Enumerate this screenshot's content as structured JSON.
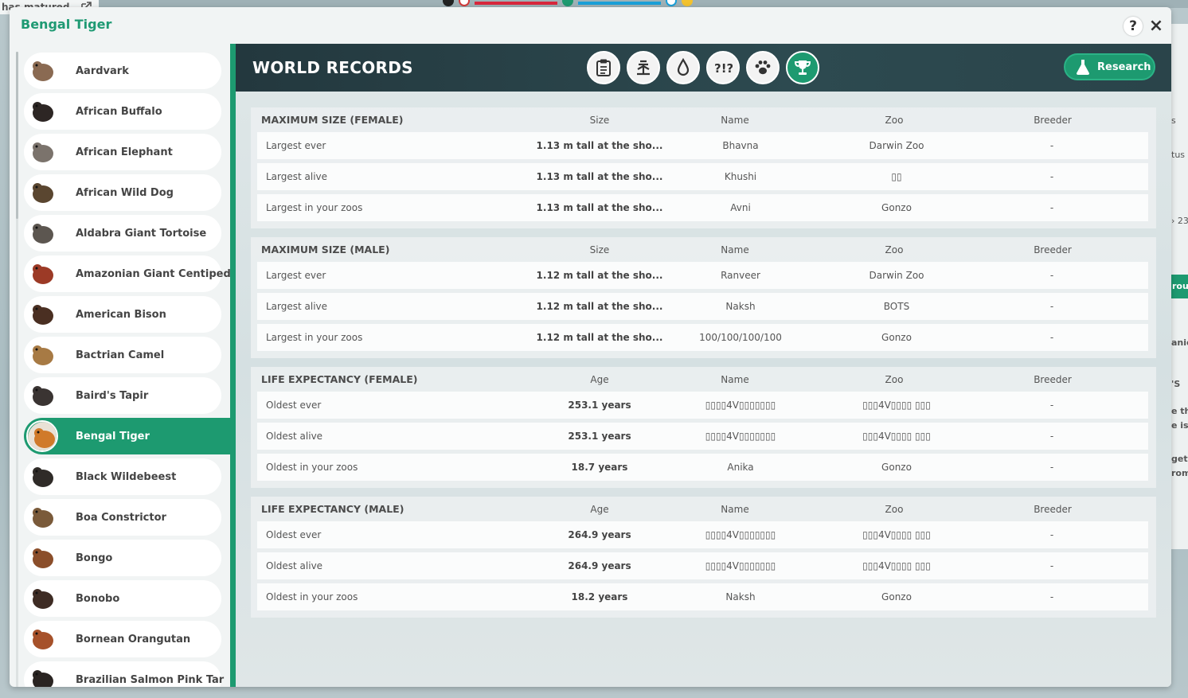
{
  "background": {
    "notice": "has matured",
    "right_fragments": [
      "s",
      "tus",
      "› 23",
      "rou",
      "anic",
      "'S",
      "e the",
      "e is.",
      "get a",
      "rom"
    ]
  },
  "window": {
    "title": "Bengal Tiger",
    "help_label": "?",
    "close_label": "×"
  },
  "sidebar": {
    "items": [
      {
        "label": "Aardvark",
        "color": "#8a6a52",
        "active": false
      },
      {
        "label": "African Buffalo",
        "color": "#2d2624",
        "active": false
      },
      {
        "label": "African Elephant",
        "color": "#7b736c",
        "active": false
      },
      {
        "label": "African Wild Dog",
        "color": "#5a4630",
        "active": false
      },
      {
        "label": "Aldabra Giant Tortoise",
        "color": "#5c5650",
        "active": false
      },
      {
        "label": "Amazonian Giant Centipede",
        "color": "#9c3a26",
        "active": false
      },
      {
        "label": "American Bison",
        "color": "#4a2f22",
        "active": false
      },
      {
        "label": "Bactrian Camel",
        "color": "#a77a44",
        "active": false
      },
      {
        "label": "Baird's Tapir",
        "color": "#3a3432",
        "active": false
      },
      {
        "label": "Bengal Tiger",
        "color": "#d07a2a",
        "active": true
      },
      {
        "label": "Black Wildebeest",
        "color": "#2f2b28",
        "active": false
      },
      {
        "label": "Boa Constrictor",
        "color": "#7a5a3a",
        "active": false
      },
      {
        "label": "Bongo",
        "color": "#8b4e2a",
        "active": false
      },
      {
        "label": "Bonobo",
        "color": "#3e2c24",
        "active": false
      },
      {
        "label": "Bornean Orangutan",
        "color": "#a6512a",
        "active": false
      },
      {
        "label": "Brazilian Salmon Pink Tar",
        "color": "#2a2422",
        "active": false
      }
    ]
  },
  "header": {
    "title": "WORLD RECORDS",
    "research_label": "Research",
    "tabs": [
      {
        "icon": "clipboard-icon"
      },
      {
        "icon": "habitat-icon"
      },
      {
        "icon": "water-drop-icon"
      },
      {
        "icon": "behaviour-icon"
      },
      {
        "icon": "paw-icon"
      },
      {
        "icon": "trophy-icon"
      }
    ]
  },
  "records": {
    "sections": [
      {
        "title": "MAXIMUM SIZE (FEMALE)",
        "columns": [
          "Size",
          "Name",
          "Zoo",
          "Breeder"
        ],
        "rows": [
          {
            "label": "Largest ever",
            "value": "1.13 m tall at the sho...",
            "name": "Bhavna",
            "zoo": "Darwin Zoo",
            "breeder": "-"
          },
          {
            "label": "Largest alive",
            "value": "1.13 m tall at the sho...",
            "name": "Khushi",
            "zoo": "▯▯",
            "breeder": "-"
          },
          {
            "label": "Largest in your zoos",
            "value": "1.13 m tall at the sho...",
            "name": "Avni",
            "zoo": "Gonzo",
            "breeder": "-"
          }
        ]
      },
      {
        "title": "MAXIMUM SIZE (MALE)",
        "columns": [
          "Size",
          "Name",
          "Zoo",
          "Breeder"
        ],
        "rows": [
          {
            "label": "Largest ever",
            "value": "1.12 m tall at the sho...",
            "name": "Ranveer",
            "zoo": "Darwin Zoo",
            "breeder": "-"
          },
          {
            "label": "Largest alive",
            "value": "1.12 m tall at the sho...",
            "name": "Naksh",
            "zoo": "BOTS",
            "breeder": "-"
          },
          {
            "label": "Largest in your zoos",
            "value": "1.12 m tall at the sho...",
            "name": "100/100/100/100",
            "zoo": "Gonzo",
            "breeder": "-"
          }
        ]
      },
      {
        "title": "LIFE EXPECTANCY (FEMALE)",
        "columns": [
          "Age",
          "Name",
          "Zoo",
          "Breeder"
        ],
        "rows": [
          {
            "label": "Oldest ever",
            "value": "253.1 years",
            "name": "▯▯▯▯4V▯▯▯▯▯▯▯",
            "zoo": "▯▯▯4V▯▯▯▯ ▯▯▯",
            "breeder": "-"
          },
          {
            "label": "Oldest alive",
            "value": "253.1 years",
            "name": "▯▯▯▯4V▯▯▯▯▯▯▯",
            "zoo": "▯▯▯4V▯▯▯▯ ▯▯▯",
            "breeder": "-"
          },
          {
            "label": "Oldest in your zoos",
            "value": "18.7 years",
            "name": "Anika",
            "zoo": "Gonzo",
            "breeder": "-"
          }
        ]
      },
      {
        "title": "LIFE EXPECTANCY (MALE)",
        "columns": [
          "Age",
          "Name",
          "Zoo",
          "Breeder"
        ],
        "rows": [
          {
            "label": "Oldest ever",
            "value": "264.9 years",
            "name": "▯▯▯▯4V▯▯▯▯▯▯▯",
            "zoo": "▯▯▯4V▯▯▯▯ ▯▯▯",
            "breeder": "-"
          },
          {
            "label": "Oldest alive",
            "value": "264.9 years",
            "name": "▯▯▯▯4V▯▯▯▯▯▯▯",
            "zoo": "▯▯▯4V▯▯▯▯ ▯▯▯",
            "breeder": "-"
          },
          {
            "label": "Oldest in your zoos",
            "value": "18.2 years",
            "name": "Naksh",
            "zoo": "Gonzo",
            "breeder": "-"
          }
        ]
      }
    ]
  },
  "colors": {
    "accent": "#1d9a70",
    "header_bg": "#23383e"
  }
}
